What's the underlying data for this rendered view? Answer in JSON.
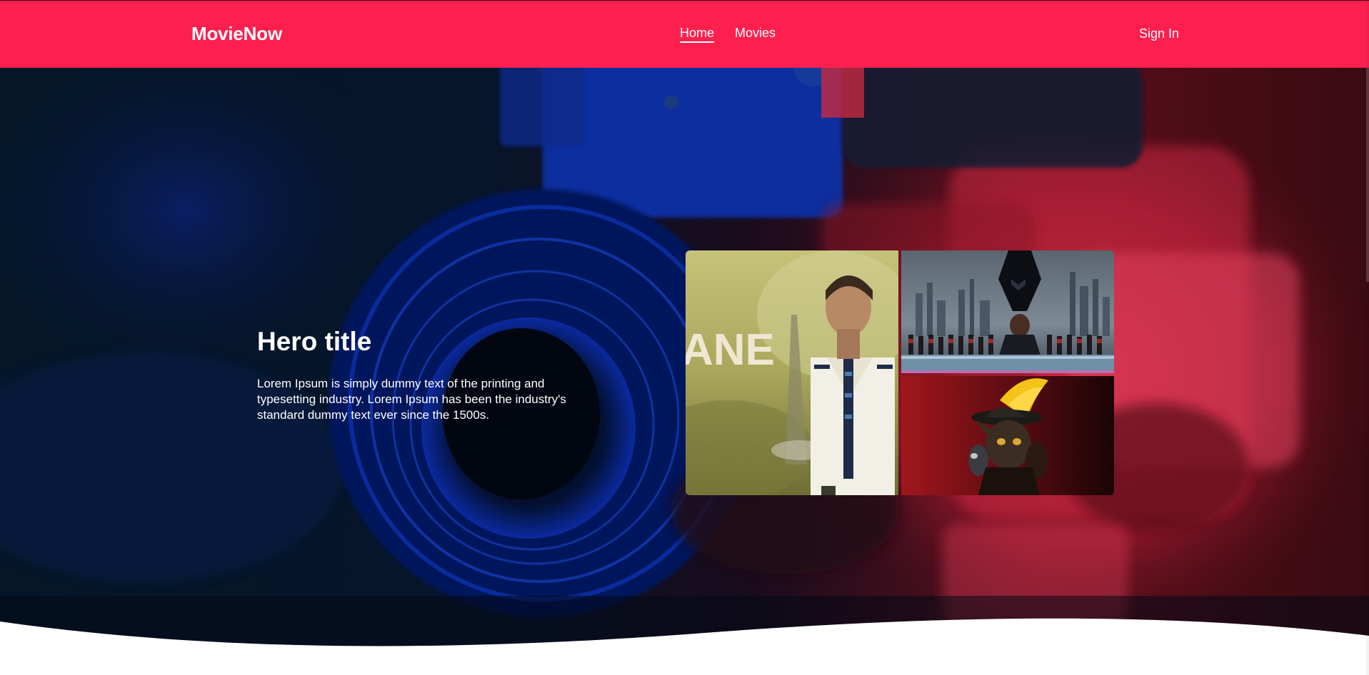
{
  "navbar": {
    "brand": "MovieNow",
    "links": [
      {
        "label": "Home",
        "active": true
      },
      {
        "label": "Movies",
        "active": false
      }
    ],
    "sign_in": "Sign In",
    "color": "#fd1f4e"
  },
  "hero": {
    "title": "Hero title",
    "text": "Lorem Ipsum is simply dummy text of the printing and typesetting industry. Lorem Ipsum has been the industry's standard dummy text ever since the 1500s.",
    "background": "camera-photo",
    "posters": [
      {
        "name": "poster-plane",
        "caption": "ANE"
      },
      {
        "name": "poster-black-panther"
      },
      {
        "name": "poster-puss-in-boots"
      }
    ]
  }
}
